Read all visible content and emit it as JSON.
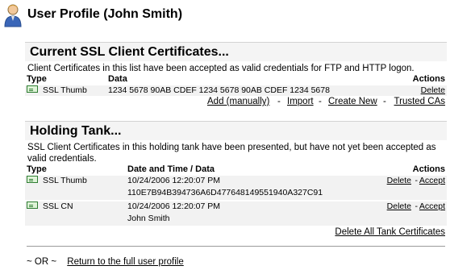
{
  "header": {
    "title": "User Profile (John Smith)"
  },
  "current": {
    "heading": "Current SSL Client Certificates...",
    "description": "Client Certificates in this list have been accepted as valid credentials for FTP and HTTP logon.",
    "columns": {
      "type": "Type",
      "data": "Data",
      "actions": "Actions"
    },
    "rows": [
      {
        "type": "SSL Thumb",
        "data": "1234 5678 90AB CDEF 1234 5678 90AB CDEF 1234 5678",
        "delete": "Delete"
      }
    ],
    "links": {
      "add": "Add (manually)",
      "import": "Import",
      "create": "Create New",
      "trusted": "Trusted CAs",
      "separator": "-"
    }
  },
  "tank": {
    "heading": "Holding Tank...",
    "description": "SSL Client Certificates in this holding tank have been presented, but have not yet been accepted as valid credentials.",
    "columns": {
      "type": "Type",
      "data": "Date and Time / Data",
      "actions": "Actions"
    },
    "rows": [
      {
        "type": "SSL Thumb",
        "datetime": "10/24/2006 12:20:07 PM",
        "data": "110E7B94B394736A6D477648149551940A327C91",
        "delete": "Delete",
        "sep": "-",
        "accept": "Accept"
      },
      {
        "type": "SSL CN",
        "datetime": "10/24/2006 12:20:07 PM",
        "data": "John Smith",
        "delete": "Delete",
        "sep": "-",
        "accept": "Accept"
      }
    ],
    "delete_all": "Delete All Tank Certificates"
  },
  "footer": {
    "or_label": "~ OR ~",
    "return_link": "Return to the full user profile"
  },
  "colors": {
    "section_bg": "#f4f4f4",
    "row_shade": "#f2f2f2",
    "cert_green": "#2e7d32"
  },
  "icons": {
    "user": "user-icon",
    "certificate": "certificate-icon"
  }
}
